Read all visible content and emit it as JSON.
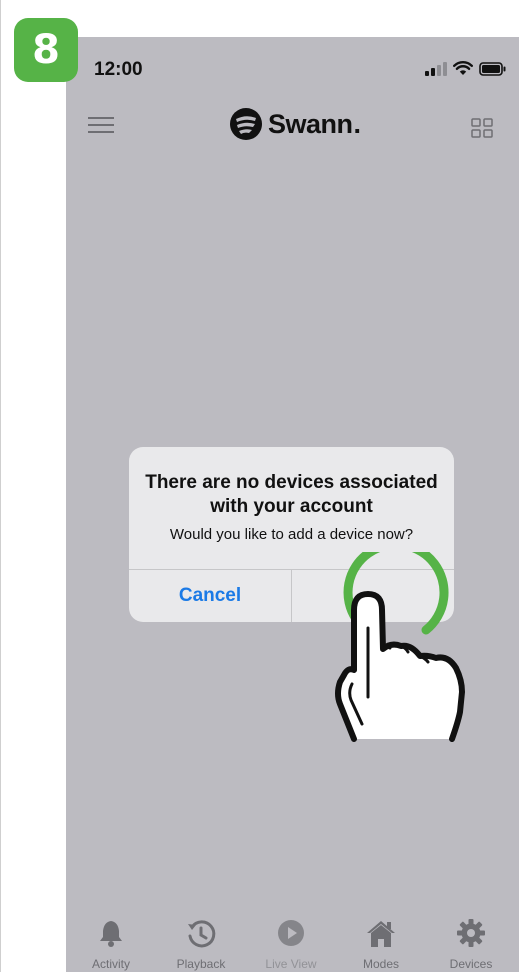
{
  "step": {
    "number": "8"
  },
  "status_bar": {
    "time": "12:00",
    "icons": [
      "signal-icon",
      "wifi-icon",
      "battery-icon"
    ]
  },
  "header": {
    "brand": "Swann",
    "brand_suffix": ".",
    "left_icon": "menu-icon",
    "right_icon": "grid-view-icon"
  },
  "dialog": {
    "title": "There are no devices associated with your account",
    "message": "Would you like to add a device now?",
    "cancel_label": "Cancel",
    "confirm_label": "",
    "accent_color": "#1b7ae6"
  },
  "overlay": {
    "gesture": "tap-hand-icon",
    "highlight_color": "#56b347"
  },
  "tab_bar": {
    "items": [
      {
        "label": "Activity",
        "icon": "bell-icon"
      },
      {
        "label": "Playback",
        "icon": "history-icon"
      },
      {
        "label": "Live View",
        "icon": "play-circle-icon"
      },
      {
        "label": "Modes",
        "icon": "home-icon"
      },
      {
        "label": "Devices",
        "icon": "gear-icon"
      }
    ]
  }
}
